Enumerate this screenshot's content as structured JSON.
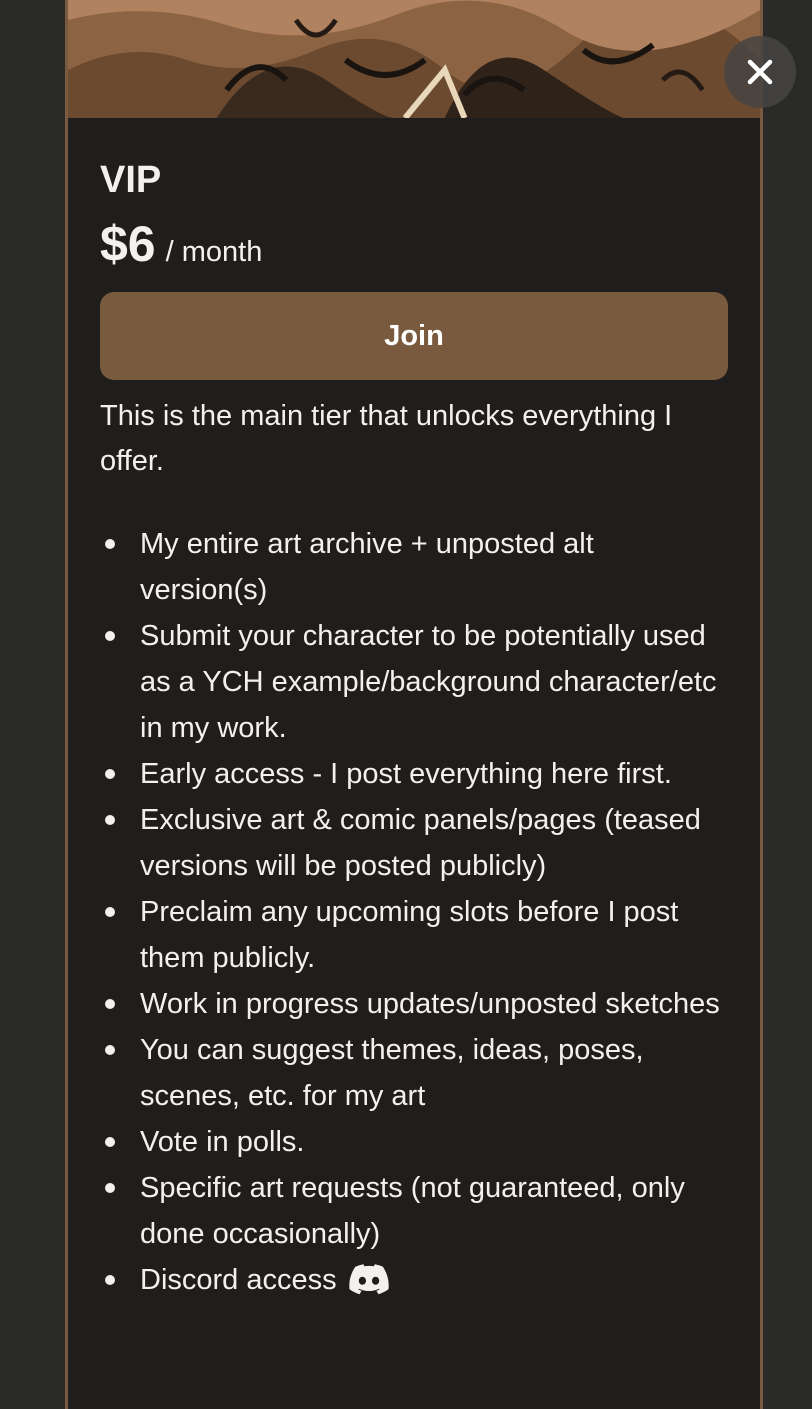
{
  "tier": {
    "name": "VIP",
    "price": "$6",
    "period": "/ month",
    "join_label": "Join",
    "description": "This is the main tier that unlocks everything I offer.",
    "perks": [
      "My entire art archive + unposted alt version(s)",
      "Submit your character to be potentially used as a YCH example/background character/etc in my work.",
      "Early access - I post everything here first.",
      "Exclusive art & comic panels/pages (teased versions will be posted publicly)",
      "Preclaim any upcoming slots before I post them publicly.",
      "Work in progress updates/unposted sketches",
      "You can suggest themes, ideas, poses, scenes, etc. for my art",
      "Vote in polls.",
      "Specific art requests (not guaranteed, only done occasionally)",
      "Discord access"
    ]
  },
  "icons": {
    "close": "close-icon",
    "discord": "discord-icon"
  },
  "colors": {
    "accent": "#7a5a3e",
    "background": "#1f1e1d",
    "text": "#f3f1ee"
  }
}
